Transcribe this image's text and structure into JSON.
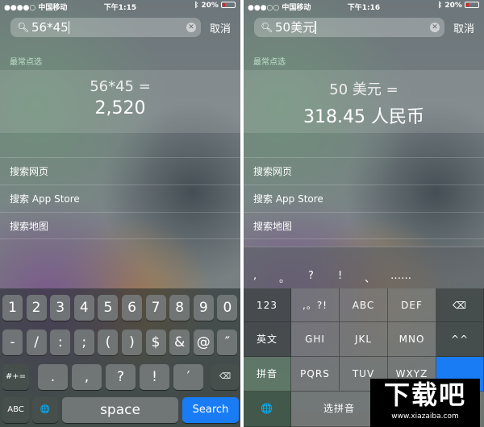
{
  "left": {
    "status": {
      "carrier": "●●●●○ 中国移动",
      "time": "下午1:15",
      "battery": "20%"
    },
    "search": {
      "value": "56*45",
      "cancel": "取消"
    },
    "section": "最常点选",
    "result": {
      "query": "56*45 =",
      "answer": "2,520"
    },
    "list": [
      "搜索网页",
      "搜索 App Store",
      "搜索地图"
    ],
    "keyboard": {
      "row1": [
        "1",
        "2",
        "3",
        "4",
        "5",
        "6",
        "7",
        "8",
        "9",
        "0"
      ],
      "row2": [
        "-",
        "/",
        ":",
        ";",
        "(",
        ")",
        "$",
        "&",
        "@",
        "″"
      ],
      "row3": {
        "shift": "#+=",
        "keys": [
          ".",
          ",",
          "?",
          "!",
          "′"
        ],
        "delete": "⌫"
      },
      "row4": {
        "abc": "ABC",
        "globe": "🌐",
        "space": "space",
        "search": "Search"
      }
    }
  },
  "right": {
    "status": {
      "carrier": "●●●○○ 中国移动",
      "time": "下午1:16",
      "battery": "20%"
    },
    "search": {
      "value": "50美元",
      "cancel": "取消"
    },
    "section": "最常点选",
    "result": {
      "query": "50 美元 =",
      "answer": "318.45 人民币"
    },
    "list": [
      "搜索网页",
      "搜索 App Store",
      "搜索地图"
    ],
    "suggestions": [
      ",",
      "。",
      "?",
      "!",
      "、",
      "……"
    ],
    "keyboard": {
      "r1": [
        "123",
        ",。?!",
        "ABC",
        "DEF",
        "⌫"
      ],
      "r2": [
        "英文",
        "GHI",
        "JKL",
        "MNO",
        "^^"
      ],
      "r3": [
        "拼音",
        "PQRS",
        "TUV",
        "WXYZ"
      ],
      "r4": [
        "🌐",
        "选拼音"
      ]
    }
  },
  "watermark": {
    "logo": "下载吧",
    "url": "www.xiazaiba.com"
  },
  "colors": {
    "accent": "#1a7cf5",
    "battery": "#e02020"
  }
}
